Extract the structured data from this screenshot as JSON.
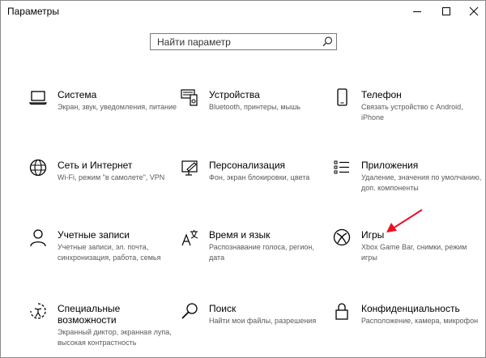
{
  "window": {
    "title": "Параметры",
    "accent_color": "#e81123"
  },
  "search": {
    "placeholder": "Найти параметр"
  },
  "categories": [
    {
      "title": "Система",
      "description": "Экран, звук, уведомления, питание",
      "icon": "laptop-icon"
    },
    {
      "title": "Устройства",
      "description": "Bluetooth, принтеры, мышь",
      "icon": "devices-icon"
    },
    {
      "title": "Телефон",
      "description": "Связать устройство с Android, iPhone",
      "icon": "phone-icon"
    },
    {
      "title": "Сеть и Интернет",
      "description": "Wi-Fi, режим \"в самолете\", VPN",
      "icon": "globe-icon"
    },
    {
      "title": "Персонализация",
      "description": "Фон, экран блокировки, цвета",
      "icon": "personalization-icon"
    },
    {
      "title": "Приложения",
      "description": "Удаление, значения по умолчанию, доп. компоненты",
      "icon": "apps-icon"
    },
    {
      "title": "Учетные записи",
      "description": "Учетные записи, эл. почта, синхронизация, работа, семья",
      "icon": "person-icon"
    },
    {
      "title": "Время и язык",
      "description": "Распознавание голоса, регион, дата",
      "icon": "time-language-icon"
    },
    {
      "title": "Игры",
      "description": "Xbox Game Bar, снимки, режим игры",
      "icon": "xbox-icon"
    },
    {
      "title": "Специальные возможности",
      "title_line1": "Специальные",
      "title_line2": "возможности",
      "description": "Экранный диктор, экранная лупа, высокая контрастность",
      "icon": "ease-of-access-icon"
    },
    {
      "title": "Поиск",
      "description": "Найти мои файлы, разрешения",
      "icon": "search-icon"
    },
    {
      "title": "Конфиденциальность",
      "description": "Расположение, камера, микрофон",
      "icon": "lock-icon"
    }
  ]
}
